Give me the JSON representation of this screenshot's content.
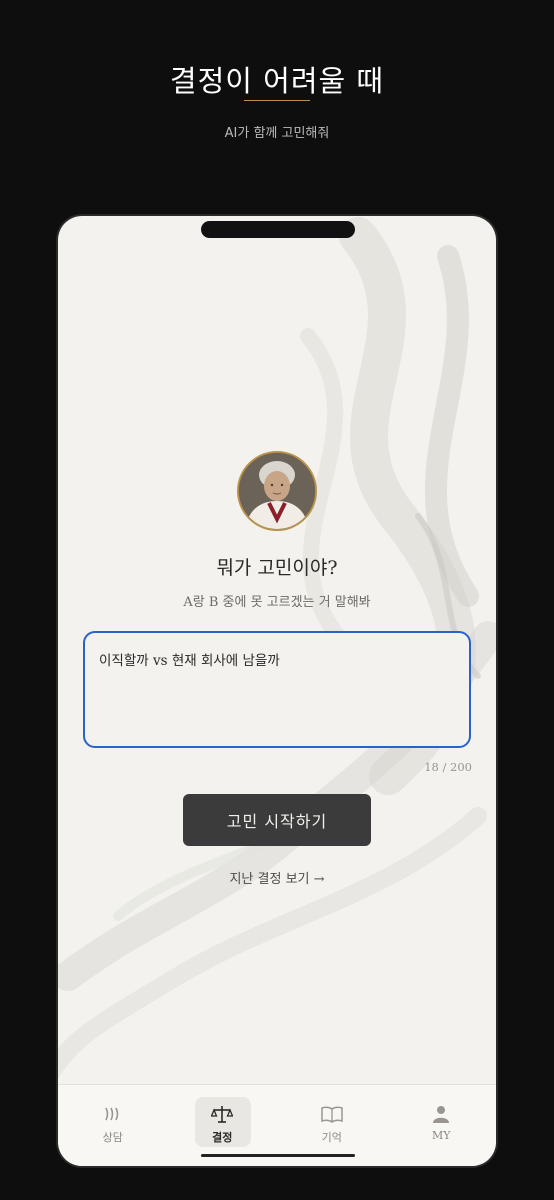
{
  "promo": {
    "title": "결정이 어려울 때",
    "subtitle": "AI가 함께 고민해줘"
  },
  "main": {
    "avatar_icon": "grandmother-portrait",
    "question": "뭐가 고민이야?",
    "instruction": "A랑 B 중에 못 고르겠는 거 말해봐",
    "input_value": "이직할까 vs 현재 회사에 남을까",
    "char_count": "18 / 200",
    "start_button": "고민 시작하기",
    "past_link": "지난 결정 보기 →"
  },
  "tabs": [
    {
      "label": "상담",
      "icon": "waves-icon",
      "active": false
    },
    {
      "label": "결정",
      "icon": "scale-icon",
      "active": true
    },
    {
      "label": "기억",
      "icon": "book-icon",
      "active": false
    },
    {
      "label": "MY",
      "icon": "person-icon",
      "active": false
    }
  ],
  "colors": {
    "accent_gold": "#b8924a",
    "input_border": "#2a63c6",
    "button_bg": "#3b3b3b"
  }
}
